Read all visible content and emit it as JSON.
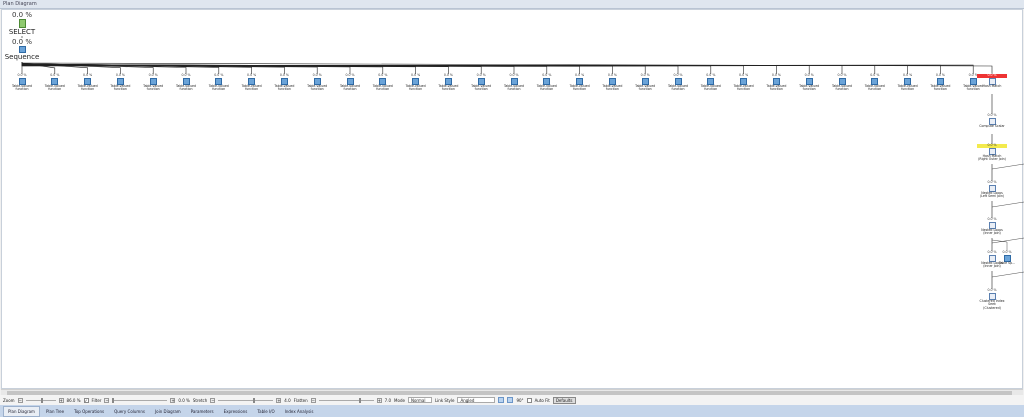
{
  "window": {
    "title": "Plan Diagram"
  },
  "select_node": {
    "cost": "0.0 %",
    "label": "SELECT"
  },
  "sequence_node": {
    "cost": "0.0 %",
    "label": "Sequence"
  },
  "tvf_nodes": {
    "count": 30,
    "cost": "0.0 %",
    "label": "Table-valued function"
  },
  "chain": [
    {
      "cost": "0.0 %",
      "label": "Hash Match",
      "sub": "",
      "style": "red"
    },
    {
      "cost": "0.0 %",
      "label": "Compute Scalar",
      "sub": "",
      "style": ""
    },
    {
      "cost": "0.0 %",
      "label": "Hash Match",
      "sub": "(Right Outer Join)",
      "style": "yel"
    },
    {
      "cost": "0.0 %",
      "label": "Nested Loops",
      "sub": "(Left Semi Join)",
      "style": ""
    },
    {
      "cost": "0.0 %",
      "label": "Nested Loops",
      "sub": "(Inner Join)",
      "style": ""
    },
    {
      "cost": "0.0 %",
      "label": "Nested Loops",
      "sub": "(Inner Join)",
      "style": ""
    },
    {
      "cost": "0.0 %",
      "label": "Clustered Index Seek",
      "sub": "(Clustered)",
      "style": ""
    }
  ],
  "table_spool": {
    "cost": "0.0 %",
    "label": "Table Sp..."
  },
  "toolbar": {
    "zoom_label": "Zoom",
    "zoom_value": "86.0 %",
    "zoom_level": 0.45,
    "filter_label": "Filter",
    "filter_checked": true,
    "filter_value": "0.0 %",
    "stretch_label": "Stretch",
    "stretch_value": "4.0",
    "flatten_label": "Flatten",
    "flatten_value": "7.0",
    "mode_label": "Mode",
    "mode_value": "Normal",
    "link_style_label": "Link Style",
    "link_style_value": "Angled",
    "rotation": "90°",
    "autofit_label": "Auto Fit",
    "autofit_checked": false,
    "defaults_label": "Defaults",
    "minus": "−",
    "plus": "+"
  },
  "tabs": [
    "Plan Diagram",
    "Plan Tree",
    "Top Operations",
    "Query Columns",
    "Join Diagram",
    "Parameters",
    "Expressions",
    "Table I/O",
    "Index Analysis"
  ]
}
